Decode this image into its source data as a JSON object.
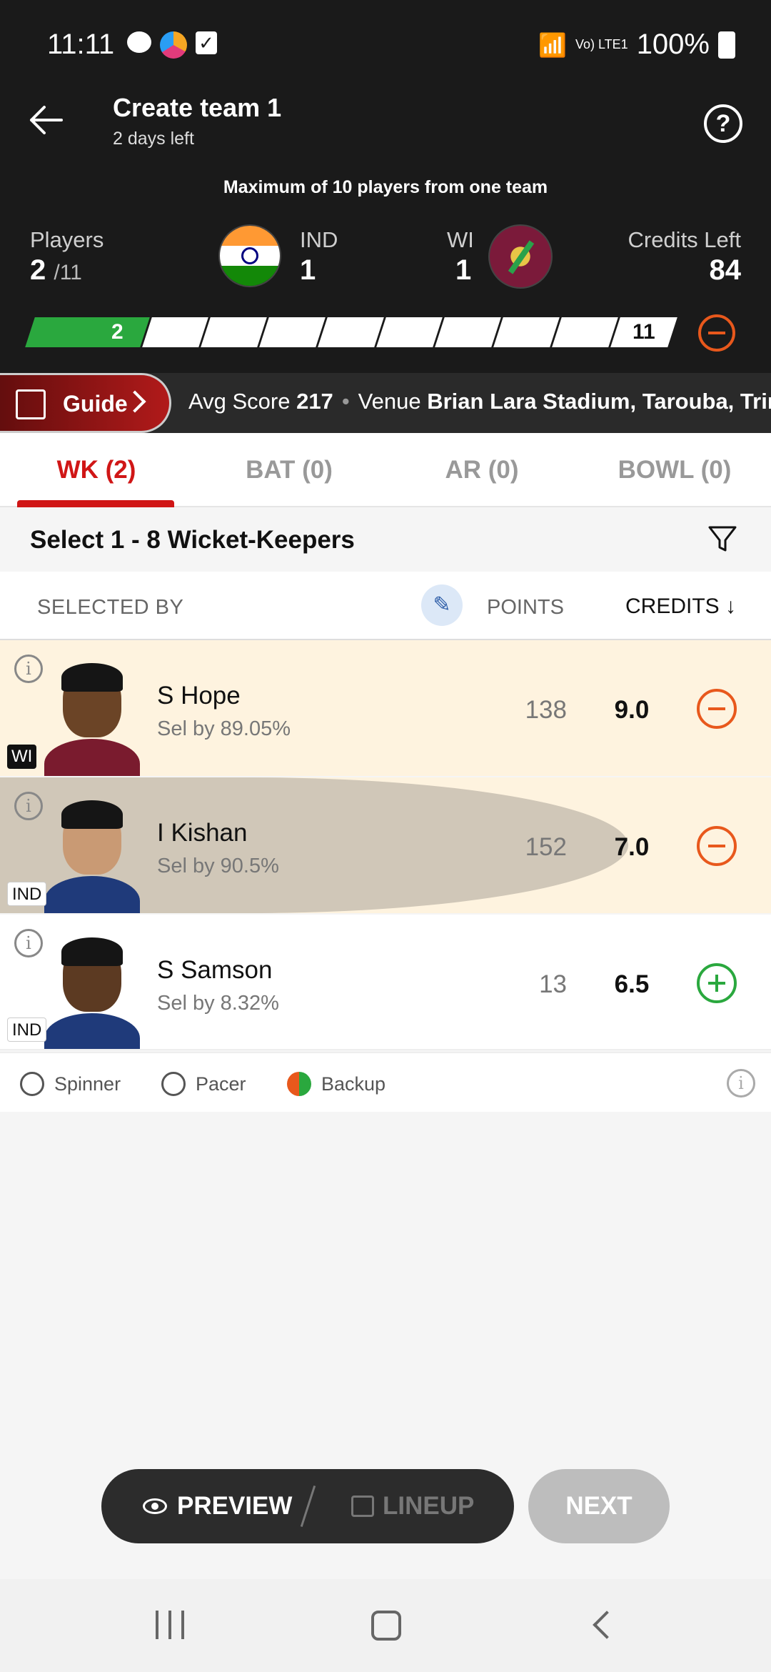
{
  "status_bar": {
    "time": "11:11",
    "battery": "100%",
    "network": "Vo) LTE1"
  },
  "header": {
    "title": "Create team 1",
    "subtitle": "2 days left",
    "max_note": "Maximum of 10 players from one team"
  },
  "summary": {
    "players_label": "Players",
    "players_selected": "2",
    "players_total": "/11",
    "team1_name": "IND",
    "team1_count": "1",
    "team2_name": "WI",
    "team2_count": "1",
    "credits_label": "Credits Left",
    "credits_left": "84"
  },
  "progress": {
    "filled_label": "2",
    "end_label": "11",
    "filled_segments": 2,
    "total_segments": 11
  },
  "info_strip": {
    "guide_label": "Guide",
    "avg_score_label": "Avg Score",
    "avg_score_value": "217",
    "venue_label": "Venue",
    "venue_value": "Brian Lara Stadium, Tarouba, Trin"
  },
  "tabs": [
    {
      "label": "WK (2)",
      "active": true
    },
    {
      "label": "BAT (0)",
      "active": false
    },
    {
      "label": "AR (0)",
      "active": false
    },
    {
      "label": "BOWL (0)",
      "active": false
    }
  ],
  "section": {
    "title": "Select 1 - 8 Wicket-Keepers"
  },
  "columns": {
    "selected_by": "SELECTED BY",
    "points": "POINTS",
    "credits": "CREDITS ↓"
  },
  "players": [
    {
      "name": "S Hope",
      "sel_by": "Sel by 89.05%",
      "points": "138",
      "credits": "9.0",
      "team": "WI",
      "selected": true
    },
    {
      "name": "I Kishan",
      "sel_by": "Sel by 90.5%",
      "points": "152",
      "credits": "7.0",
      "team": "IND",
      "selected": true
    },
    {
      "name": "S Samson",
      "sel_by": "Sel by 8.32%",
      "points": "13",
      "credits": "6.5",
      "team": "IND",
      "selected": false
    }
  ],
  "legend": {
    "spinner": "Spinner",
    "pacer": "Pacer",
    "backup": "Backup"
  },
  "actions": {
    "preview": "PREVIEW",
    "lineup": "LINEUP",
    "next": "NEXT"
  },
  "colors": {
    "accent_red": "#d01616",
    "header_bg": "#1a1a1a",
    "green": "#2aa83e",
    "orange": "#e8581c",
    "selected_row": "#fef3df"
  }
}
